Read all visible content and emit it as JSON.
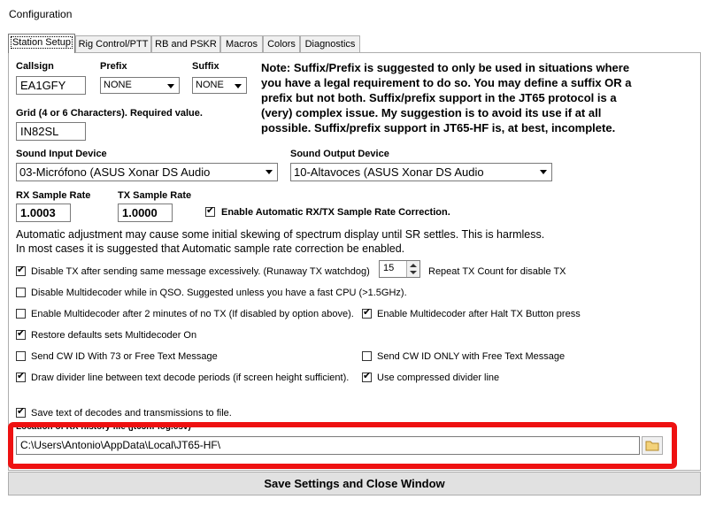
{
  "window": {
    "title": "Configuration"
  },
  "tabs": [
    {
      "label": "Station Setup",
      "active": true
    },
    {
      "label": "Rig Control/PTT"
    },
    {
      "label": "RB and PSKR"
    },
    {
      "label": "Macros"
    },
    {
      "label": "Colors"
    },
    {
      "label": "Diagnostics"
    }
  ],
  "station": {
    "callsign_label": "Callsign",
    "callsign_value": "EA1GFY",
    "prefix_label": "Prefix",
    "prefix_value": "NONE",
    "suffix_label": "Suffix",
    "suffix_value": "NONE",
    "grid_label": "Grid (4 or 6 Characters).  Required value.",
    "grid_value": "IN82SL"
  },
  "note": "Note:  Suffix/Prefix is suggested to only be used in situations where you have a legal requirement to do so.  You may define a suffix OR a prefix but not both.  Suffix/prefix support in the JT65 protocol is a (very) complex issue.  My suggestion is to avoid its use if at all possible.  Suffix/prefix support in JT65-HF is, at best, incomplete.",
  "sound": {
    "input_label": "Sound Input Device",
    "input_value": "03-Micrófono (ASUS Xonar DS Audio",
    "output_label": "Sound Output Device",
    "output_value": "10-Altavoces (ASUS Xonar DS Audio"
  },
  "sample": {
    "rx_label": "RX Sample Rate",
    "rx_value": "1.0003",
    "tx_label": "TX Sample Rate",
    "tx_value": "1.0000",
    "auto_label": "Enable Automatic RX/TX Sample Rate Correction."
  },
  "auto_text_1": "Automatic adjustment may cause some initial skewing of spectrum display until SR settles.  This is harmless.",
  "auto_text_2": "In most cases it is suggested that Automatic sample rate correction be enabled.",
  "options": {
    "disable_tx": "Disable TX after sending same message excessively. (Runaway TX watchdog)",
    "repeat_count": "15",
    "repeat_label": "Repeat TX Count for disable TX",
    "disable_multi_qso": "Disable Multidecoder while in QSO.  Suggested unless you have a fast CPU (>1.5GHz).",
    "enable_multi_2min": "Enable Multidecoder after 2 minutes of no TX (If disabled by option above).",
    "enable_multi_halt": "Enable Multidecoder after Halt TX Button press",
    "restore_defaults": "Restore defaults sets Multidecoder On",
    "send_cw_73": "Send CW ID With 73 or Free Text Message",
    "send_cw_only": "Send CW ID ONLY with Free Text Message",
    "draw_divider": "Draw divider line between text decode periods (if screen height sufficient).",
    "compressed_divider": "Use compressed divider line",
    "save_text": "Save text of decodes and transmissions to file."
  },
  "history": {
    "label": "Location of RX history file (jt65hf-log.csv)",
    "path": "C:\\Users\\Antonio\\AppData\\Local\\JT65-HF\\"
  },
  "save_button": "Save Settings and Close Window"
}
